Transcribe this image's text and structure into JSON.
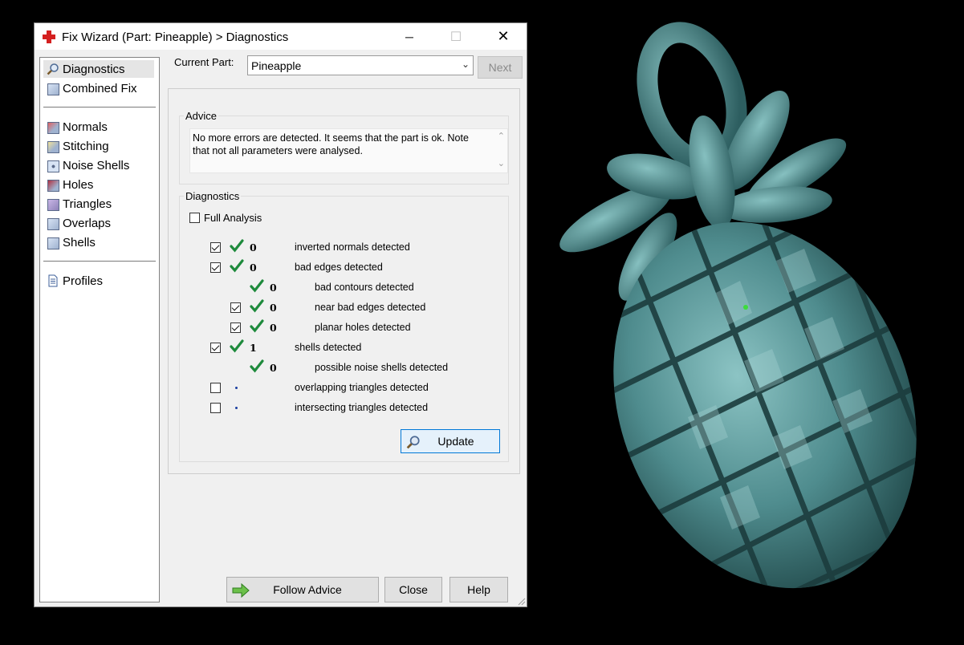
{
  "window": {
    "title": "Fix Wizard (Part: Pineapple) > Diagnostics",
    "icon": "red-cross-icon"
  },
  "titlebar_buttons": {
    "minimize": "─",
    "maximize": "☐",
    "close": "✕"
  },
  "sidebar": {
    "group1": [
      {
        "label": "Diagnostics",
        "icon": "magnifier-icon",
        "selected": true
      },
      {
        "label": "Combined Fix",
        "icon": "cube-icon"
      }
    ],
    "group2": [
      {
        "label": "Normals",
        "icon": "normals-cube-icon"
      },
      {
        "label": "Stitching",
        "icon": "stitching-cube-icon"
      },
      {
        "label": "Noise Shells",
        "icon": "noise-shells-icon"
      },
      {
        "label": "Holes",
        "icon": "holes-cube-icon"
      },
      {
        "label": "Triangles",
        "icon": "triangles-cube-icon"
      },
      {
        "label": "Overlaps",
        "icon": "overlaps-cube-icon"
      },
      {
        "label": "Shells",
        "icon": "shells-cube-icon"
      }
    ],
    "group3": [
      {
        "label": "Profiles",
        "icon": "document-icon"
      }
    ]
  },
  "current_part": {
    "label": "Current Part:",
    "value": "Pineapple"
  },
  "next_button": "Next",
  "advice": {
    "title": "Advice",
    "text": "No more errors are detected. It seems that the part is ok. Note that not all parameters were analysed."
  },
  "diagnostics": {
    "title": "Diagnostics",
    "full_analysis": "Full Analysis",
    "rows": [
      {
        "count": "0",
        "text": "inverted normals detected",
        "checked": true,
        "indent": 0,
        "status": "ok"
      },
      {
        "count": "0",
        "text": "bad edges detected",
        "checked": true,
        "indent": 0,
        "status": "ok"
      },
      {
        "count": "0",
        "text": "bad contours detected",
        "checkbox": false,
        "indent": 1,
        "status": "ok"
      },
      {
        "count": "0",
        "text": "near bad edges detected",
        "checked": true,
        "indent": 1,
        "status": "ok"
      },
      {
        "count": "0",
        "text": "planar holes detected",
        "checked": true,
        "indent": 1,
        "status": "ok"
      },
      {
        "count": "1",
        "text": "shells detected",
        "checked": true,
        "indent": 0,
        "status": "ok"
      },
      {
        "count": "0",
        "text": "possible noise shells detected",
        "checkbox": false,
        "indent": 1,
        "status": "ok"
      },
      {
        "count": "",
        "text": "overlapping triangles detected",
        "checked": false,
        "indent": 0,
        "status": "pending"
      },
      {
        "count": "",
        "text": "intersecting triangles detected",
        "checked": false,
        "indent": 0,
        "status": "pending"
      }
    ],
    "update_button": "Update"
  },
  "footer": {
    "follow_advice": "Follow Advice",
    "close": "Close",
    "help": "Help"
  },
  "colors": {
    "accent_green": "#1e8a3c",
    "model_teal": "#5a9a9a",
    "dialog_bg": "#f0f0f0"
  }
}
